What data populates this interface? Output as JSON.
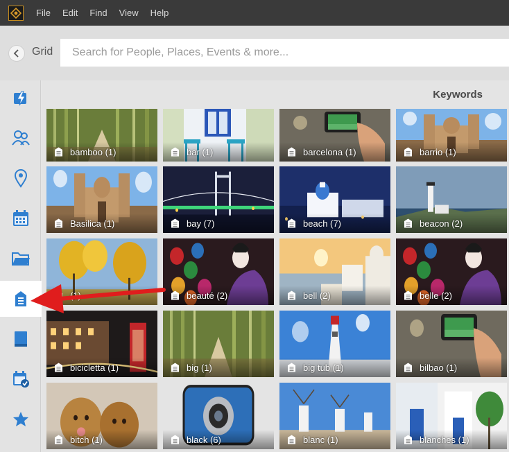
{
  "menu": {
    "items": [
      "File",
      "Edit",
      "Find",
      "View",
      "Help"
    ]
  },
  "search": {
    "view_label": "Grid",
    "placeholder": "Search for People, Places, Events & more..."
  },
  "sidebar": {
    "items": [
      {
        "name": "instant-fix",
        "icon": "lightning-photo-icon"
      },
      {
        "name": "people",
        "icon": "people-icon"
      },
      {
        "name": "places",
        "icon": "map-pin-icon"
      },
      {
        "name": "events",
        "icon": "calendar-icon"
      },
      {
        "name": "folders",
        "icon": "folder-icon"
      },
      {
        "name": "keywords",
        "icon": "keyword-tag-icon",
        "active": true
      },
      {
        "name": "albums",
        "icon": "album-icon"
      },
      {
        "name": "saved-searches",
        "icon": "calendar-check-icon"
      },
      {
        "name": "ratings",
        "icon": "star-icon"
      }
    ]
  },
  "main": {
    "section_title": "Keywords",
    "tiles": [
      {
        "label": "bamboo (1)",
        "scene": "bamboo"
      },
      {
        "label": "bar (1)",
        "scene": "bar"
      },
      {
        "label": "barcelona (1)",
        "scene": "phone"
      },
      {
        "label": "barrio (1)",
        "scene": "church"
      },
      {
        "label": "Basilica (1)",
        "scene": "church"
      },
      {
        "label": "bay (7)",
        "scene": "bridge"
      },
      {
        "label": "beach (7)",
        "scene": "beachnight"
      },
      {
        "label": "beacon (2)",
        "scene": "lighthouse"
      },
      {
        "label": "(1)",
        "scene": "autumn"
      },
      {
        "label": "beauté (2)",
        "scene": "geisha"
      },
      {
        "label": "bell (2)",
        "scene": "santorini"
      },
      {
        "label": "belle (2)",
        "scene": "geisha"
      },
      {
        "label": "bicicletta (1)",
        "scene": "london"
      },
      {
        "label": "big (1)",
        "scene": "bamboo"
      },
      {
        "label": "big tub (1)",
        "scene": "whitelighthouse"
      },
      {
        "label": "bilbao (1)",
        "scene": "phone"
      },
      {
        "label": "bitch (1)",
        "scene": "puppies"
      },
      {
        "label": "black (6)",
        "scene": "camera"
      },
      {
        "label": "blanc (1)",
        "scene": "windmills"
      },
      {
        "label": "blanches (1)",
        "scene": "greekwhite"
      }
    ]
  },
  "colors": {
    "menubar": "#3a3a3a",
    "accent_blue": "#2f7fd0",
    "arrow_red": "#e01d1d"
  }
}
